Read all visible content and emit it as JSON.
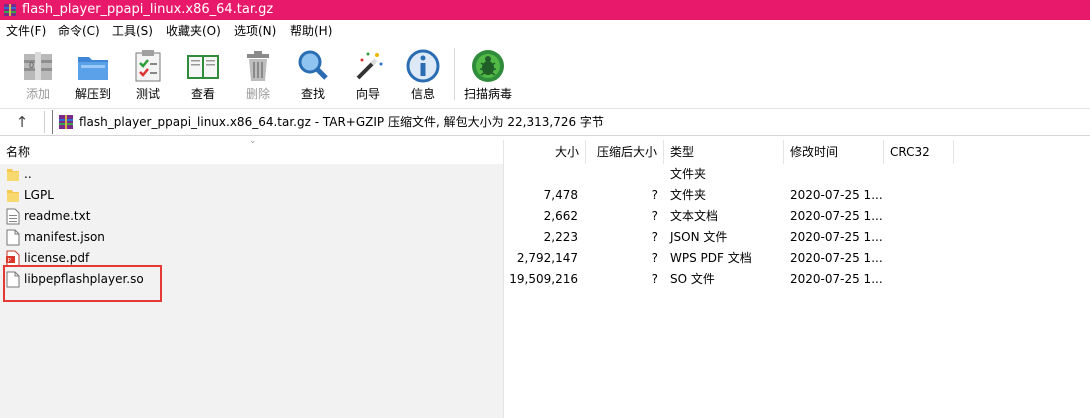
{
  "window": {
    "title": "flash_player_ppapi_linux.x86_64.tar.gz"
  },
  "menu": [
    "文件(F)",
    "命令(C)",
    "工具(S)",
    "收藏夹(O)",
    "选项(N)",
    "帮助(H)"
  ],
  "toolbar": [
    {
      "label": "添加",
      "icon": "add-archive-icon",
      "enabled": false
    },
    {
      "label": "解压到",
      "icon": "extract-folder-icon",
      "enabled": true
    },
    {
      "label": "测试",
      "icon": "test-clipboard-icon",
      "enabled": true
    },
    {
      "label": "查看",
      "icon": "view-book-icon",
      "enabled": true
    },
    {
      "label": "删除",
      "icon": "trash-can-icon",
      "enabled": false
    },
    {
      "label": "查找",
      "icon": "magnifier-icon",
      "enabled": true
    },
    {
      "label": "向导",
      "icon": "magic-wand-icon",
      "enabled": true
    },
    {
      "label": "信息",
      "icon": "info-icon",
      "enabled": true
    },
    {
      "label": "扫描病毒",
      "icon": "virus-scan-icon",
      "enabled": true
    }
  ],
  "address": {
    "up_icon": "↑",
    "text": "flash_player_ppapi_linux.x86_64.tar.gz - TAR+GZIP 压缩文件, 解包大小为 22,313,726 字节"
  },
  "columns": {
    "name": "名称",
    "size": "大小",
    "packed": "压缩后大小",
    "type": "类型",
    "modified": "修改时间",
    "crc": "CRC32"
  },
  "files": [
    {
      "name": "..",
      "icon": "folder-icon",
      "size": "",
      "packed": "",
      "type": "文件夹",
      "modified": ""
    },
    {
      "name": "LGPL",
      "icon": "folder-icon",
      "size": "7,478",
      "packed": "?",
      "type": "文件夹",
      "modified": "2020-07-25 1..."
    },
    {
      "name": "readme.txt",
      "icon": "text-file-icon",
      "size": "2,662",
      "packed": "?",
      "type": "文本文档",
      "modified": "2020-07-25 1..."
    },
    {
      "name": "manifest.json",
      "icon": "blank-file-icon",
      "size": "2,223",
      "packed": "?",
      "type": "JSON 文件",
      "modified": "2020-07-25 1..."
    },
    {
      "name": "license.pdf",
      "icon": "pdf-file-icon",
      "size": "2,792,147",
      "packed": "?",
      "type": "WPS PDF 文档",
      "modified": "2020-07-25 1..."
    },
    {
      "name": "libpepflashplayer.so",
      "icon": "blank-file-icon",
      "size": "19,509,216",
      "packed": "?",
      "type": "SO 文件",
      "modified": "2020-07-25 1..."
    }
  ],
  "colors": {
    "titlebar": "#e8196a",
    "highlight_box": "#e53935"
  }
}
